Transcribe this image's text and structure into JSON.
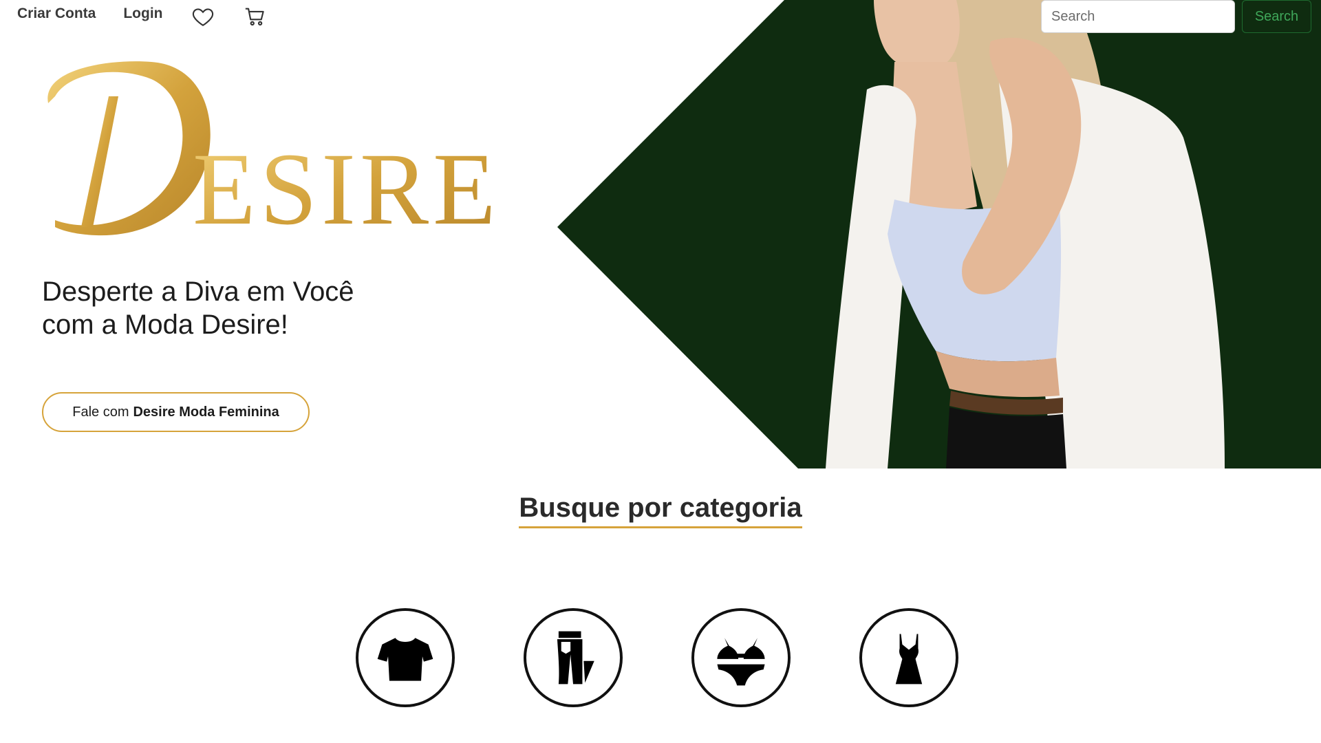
{
  "nav": {
    "create_account": "Criar Conta",
    "login": "Login",
    "favorites_icon": "heart-icon",
    "cart_icon": "cart-icon"
  },
  "search": {
    "placeholder": "Search",
    "button_label": "Search"
  },
  "hero": {
    "logo_text": "DESIRE",
    "tagline_line1": "Desperte a Diva em Você",
    "tagline_line2": "com a Moda Desire!",
    "cta_prefix": "Fale com",
    "cta_bold": "Desire Moda Feminina"
  },
  "categories_section": {
    "title": "Busque por categoria",
    "items": [
      {
        "icon": "tshirt-icon"
      },
      {
        "icon": "pants-icon"
      },
      {
        "icon": "lingerie-icon"
      },
      {
        "icon": "dress-icon"
      }
    ]
  },
  "colors": {
    "brand_green": "#0f2c10",
    "gold": "#d6a33a",
    "search_green": "#3fa75a"
  }
}
